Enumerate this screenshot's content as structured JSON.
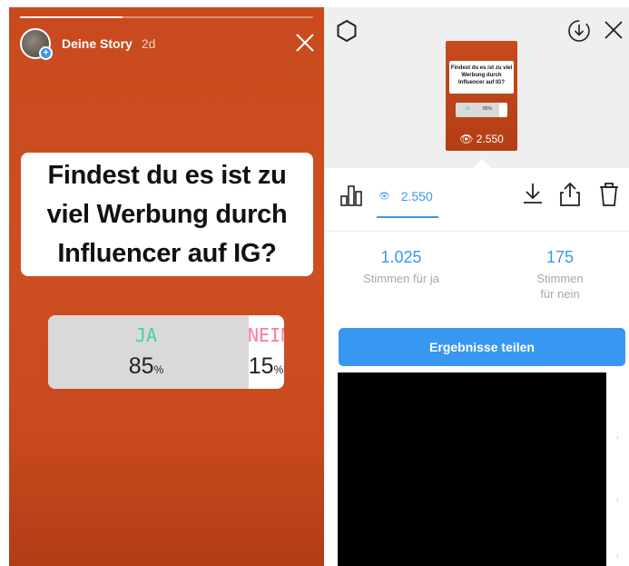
{
  "story": {
    "progress_fraction": 0.35,
    "username": "Deine Story",
    "time": "2d",
    "question": "Findest du es ist zu viel Werbung durch Influencer auf IG?",
    "poll": {
      "yes_label": "JA",
      "no_label": "NEIN",
      "yes_percent": "85",
      "no_percent": "15",
      "percent_sign": "%",
      "yes_fraction": 0.85
    },
    "icons": {
      "avatar_badge": "plus-badge-icon",
      "close": "close-icon"
    },
    "colors": {
      "background": "#c84a1e",
      "yes": "#43d2a4",
      "no": "#f57fa0"
    }
  },
  "insights": {
    "thumbnail": {
      "question": "Findest du es ist zu viel Werbung durch Influencer auf IG?",
      "poll_yes": "JA",
      "poll_yes_percent": "85%",
      "views": "2.550"
    },
    "tabs": {
      "views_count": "2.550"
    },
    "results": {
      "yes_count": "1.025",
      "yes_label": "Stimmen für ja",
      "no_count": "175",
      "no_label_line1": "Stimmen",
      "no_label_line2": "für nein"
    },
    "share_button": "Ergebnisse teilen",
    "icons": {
      "settings": "gear-icon",
      "download_circle": "download-circle-icon",
      "close": "close-icon",
      "chart": "bar-chart-icon",
      "eye": "eye-icon",
      "download": "download-icon",
      "share": "share-icon",
      "delete": "trash-icon"
    },
    "colors": {
      "accent": "#3897f0"
    }
  }
}
